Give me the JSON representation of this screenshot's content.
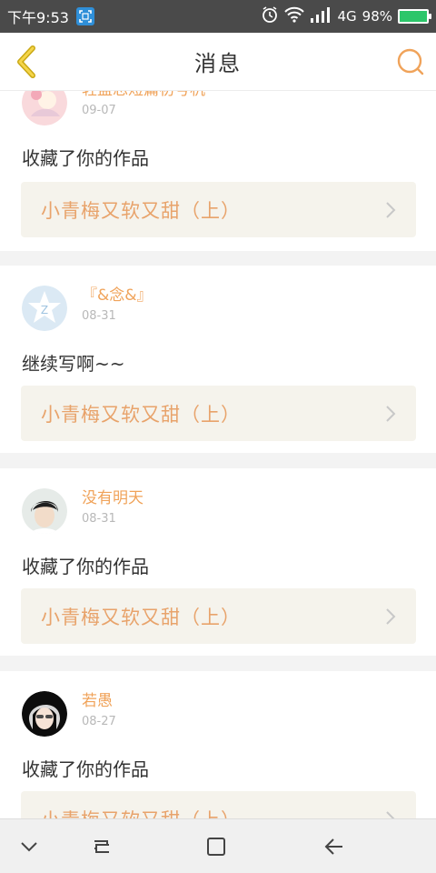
{
  "status_bar": {
    "time": "下午9:53",
    "network": "4G",
    "battery": "98%"
  },
  "header": {
    "title": "消息",
    "back_icon": "chevron-left-icon",
    "search_icon": "search-icon"
  },
  "colors": {
    "accent": "#f0a35a",
    "status_bar": "#4a4a4a",
    "link_bg": "#f5f3ec"
  },
  "messages": [
    {
      "username": "轻盈忘短篇初号机",
      "date": "09-07",
      "text": "收藏了你的作品",
      "work_title": "小青梅又软又甜（上）"
    },
    {
      "username": "『&念&』",
      "date": "08-31",
      "text": "继续写啊~~",
      "work_title": "小青梅又软又甜（上）"
    },
    {
      "username": "没有明天",
      "date": "08-31",
      "text": "收藏了你的作品",
      "work_title": "小青梅又软又甜（上）"
    },
    {
      "username": "若愚",
      "date": "08-27",
      "text": "收藏了你的作品",
      "work_title": "小青梅又软又甜（上）"
    }
  ]
}
